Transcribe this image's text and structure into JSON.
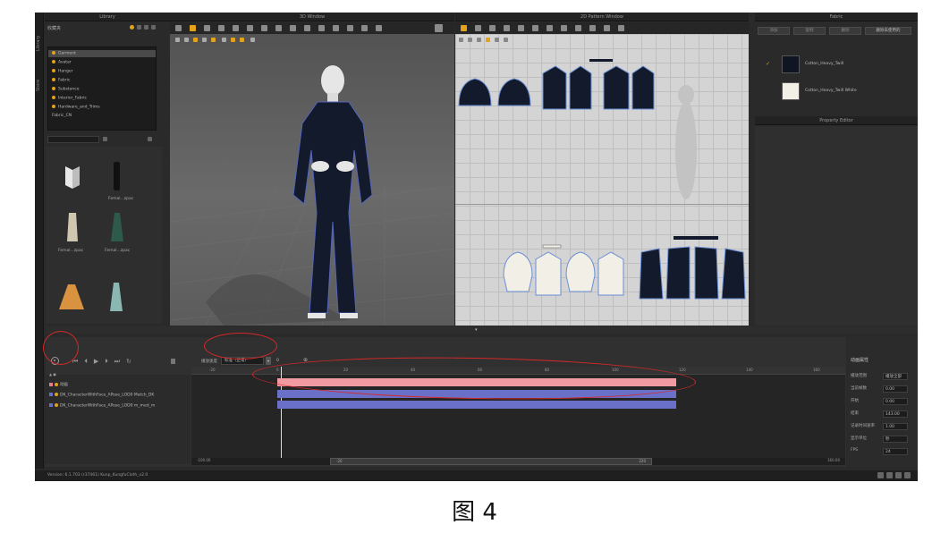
{
  "panels": {
    "library": "Library",
    "window3d": "3D Window",
    "window2d": "2D Pattern Window",
    "fabric": "Fabric",
    "property_editor": "Property Editor"
  },
  "side_tabs": [
    "Library",
    "Store"
  ],
  "library": {
    "path_label": "收藏夹",
    "tree": [
      "Garment",
      "Avatar",
      "Hanger",
      "Fabric",
      "Substance",
      "Interior_Fabric",
      "Hardware_and_Trims",
      "Fabric_CN"
    ],
    "thumbnails": [
      {
        "label": ""
      },
      {
        "label": "Femal...zpac"
      },
      {
        "label": "Femal...zpac"
      },
      {
        "label": "Femal...zpac"
      },
      {
        "label": ""
      },
      {
        "label": ""
      }
    ]
  },
  "fabric": {
    "buttons": [
      "添加",
      "复制",
      "删除",
      "删除未使用的"
    ],
    "items": [
      {
        "name": "Cotton_Heavy_Twill",
        "checked": true,
        "swatch": "#0f1522"
      },
      {
        "name": "Cotton_Heavy_Twill White",
        "checked": false,
        "swatch": "#f2efe6"
      }
    ]
  },
  "animation": {
    "mode_label": "播放速度",
    "mode_value": "标准（正常）",
    "frame_value": "0",
    "ruler_ticks": [
      "-20",
      "0",
      "20",
      "40",
      "60",
      "80",
      "100",
      "120",
      "140",
      "160",
      "180"
    ],
    "tracks": [
      {
        "name": "动画",
        "color": "#e87d8a"
      },
      {
        "name": "DK_CharacterWithFace_APose_LOD0 Match_DK",
        "color": "#6a70c8"
      },
      {
        "name": "DK_CharacterWithFace_APose_LOD0 m_med_m",
        "color": "#6a70c8"
      }
    ],
    "scroll_start": "-100.00",
    "scroll_mid_left": "-20",
    "scroll_mid_right": "220",
    "scroll_end": "160.00"
  },
  "properties": {
    "title": "动画属性",
    "rows": [
      {
        "label": "播放范围",
        "value": "播放全部"
      },
      {
        "label": "当前帧数",
        "value": "0.00"
      },
      {
        "label": "开始",
        "value": "0.00"
      },
      {
        "label": "结束",
        "value": "143.00"
      },
      {
        "label": "记录时间速率",
        "value": "1.00"
      },
      {
        "label": "显示单位",
        "value": "秒"
      },
      {
        "label": "FPS",
        "value": "24"
      }
    ]
  },
  "status": "Version: 6.1.703 (r37461)   Kunp_KungfuCloth_v2.0",
  "caption": "图 4",
  "colors": {
    "annotation": "#d62828",
    "garment": "#121a2c",
    "track_pink": "#e87d8a",
    "track_blue": "#6a70c8"
  }
}
